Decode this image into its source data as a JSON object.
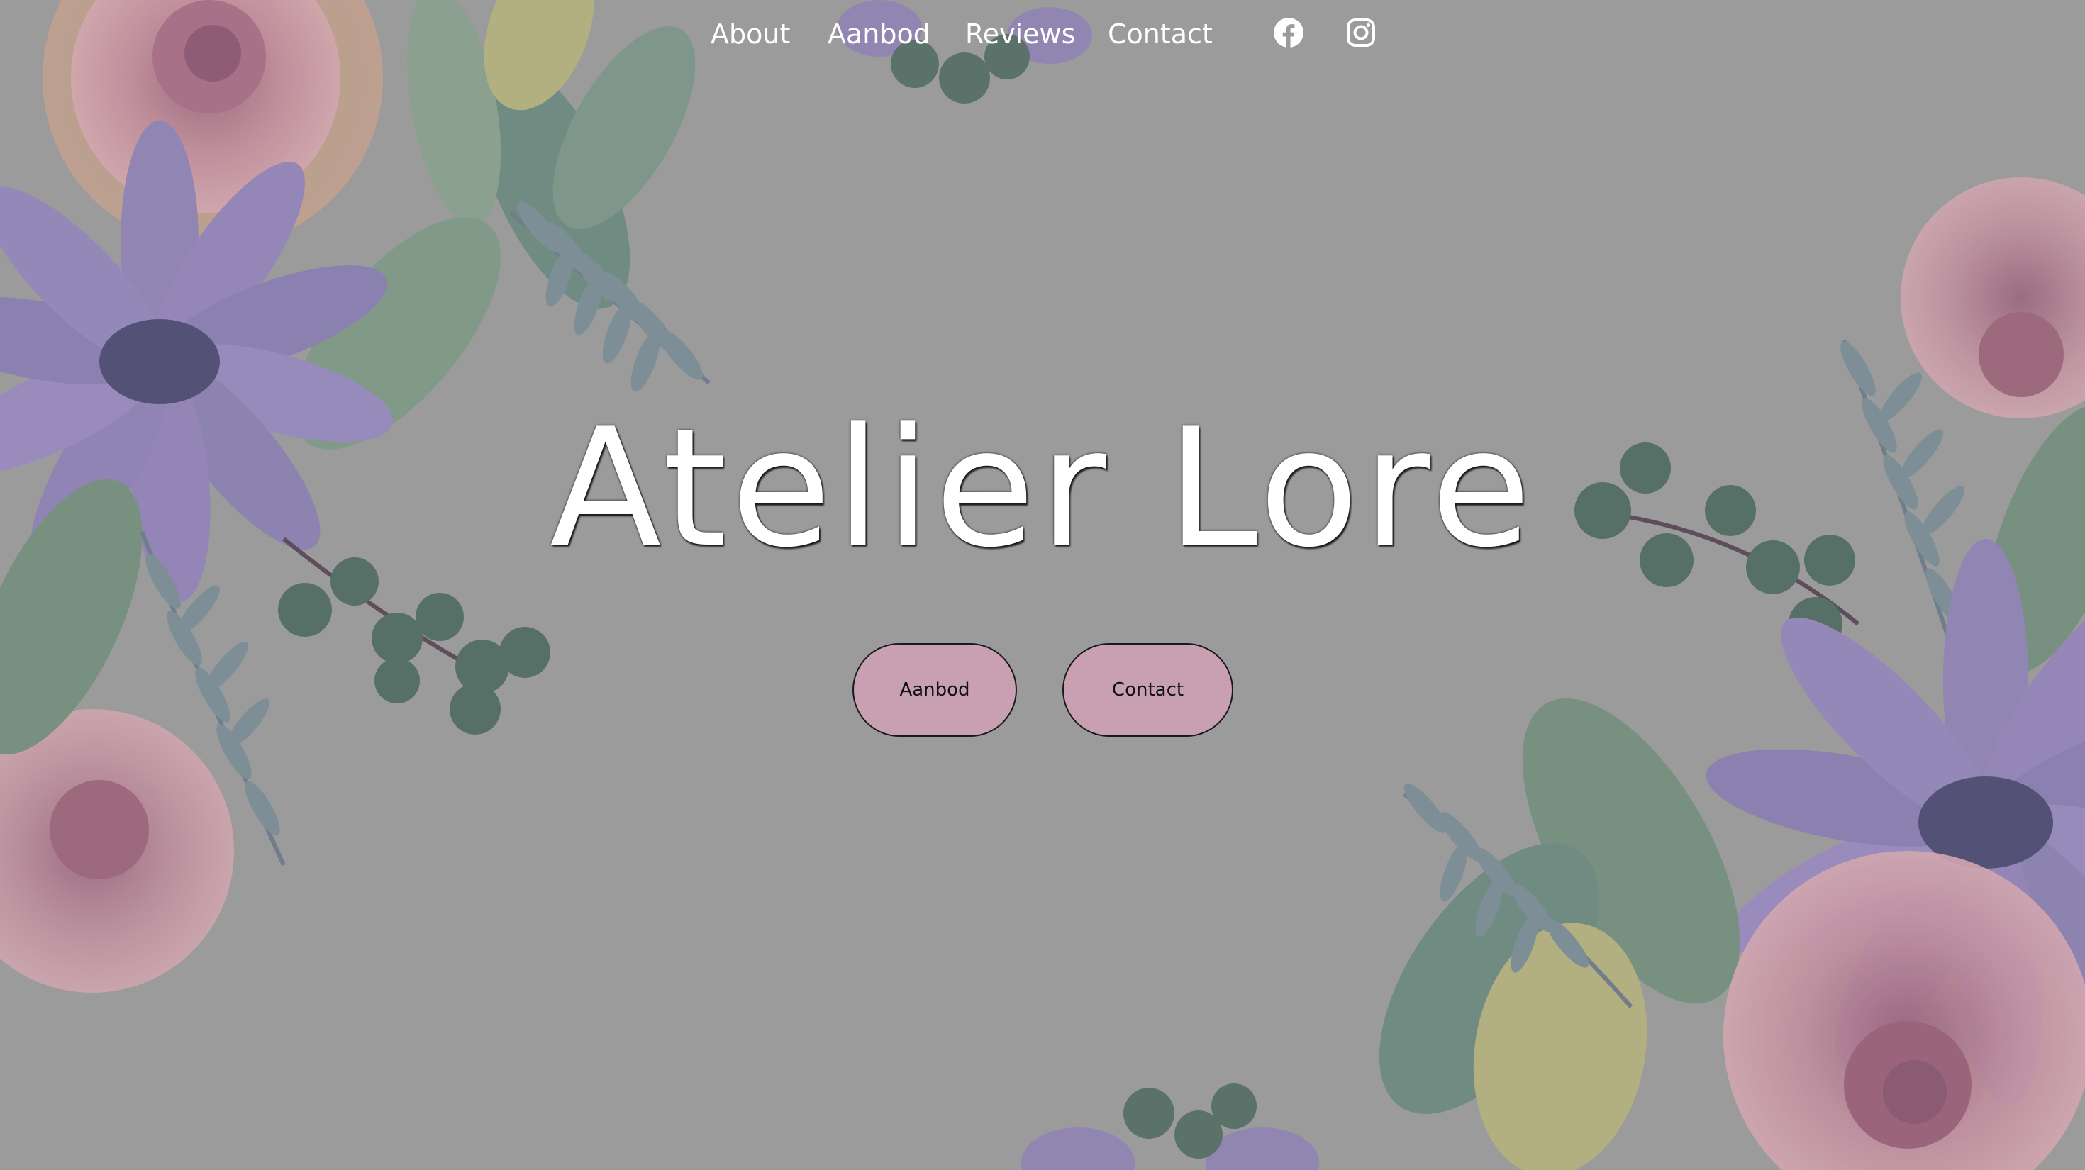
{
  "nav": {
    "links": [
      {
        "label": "About"
      },
      {
        "label": "Aanbod"
      },
      {
        "label": "Reviews"
      },
      {
        "label": "Contact"
      }
    ],
    "social": [
      {
        "icon": "facebook-icon"
      },
      {
        "icon": "instagram-icon"
      }
    ]
  },
  "hero": {
    "title": "Atelier Lore",
    "buttons": [
      {
        "label": "Aanbod"
      },
      {
        "label": "Contact"
      }
    ]
  },
  "colors": {
    "background": "#9b9b9b",
    "button": "#c9a0b1",
    "text": "#ffffff"
  }
}
